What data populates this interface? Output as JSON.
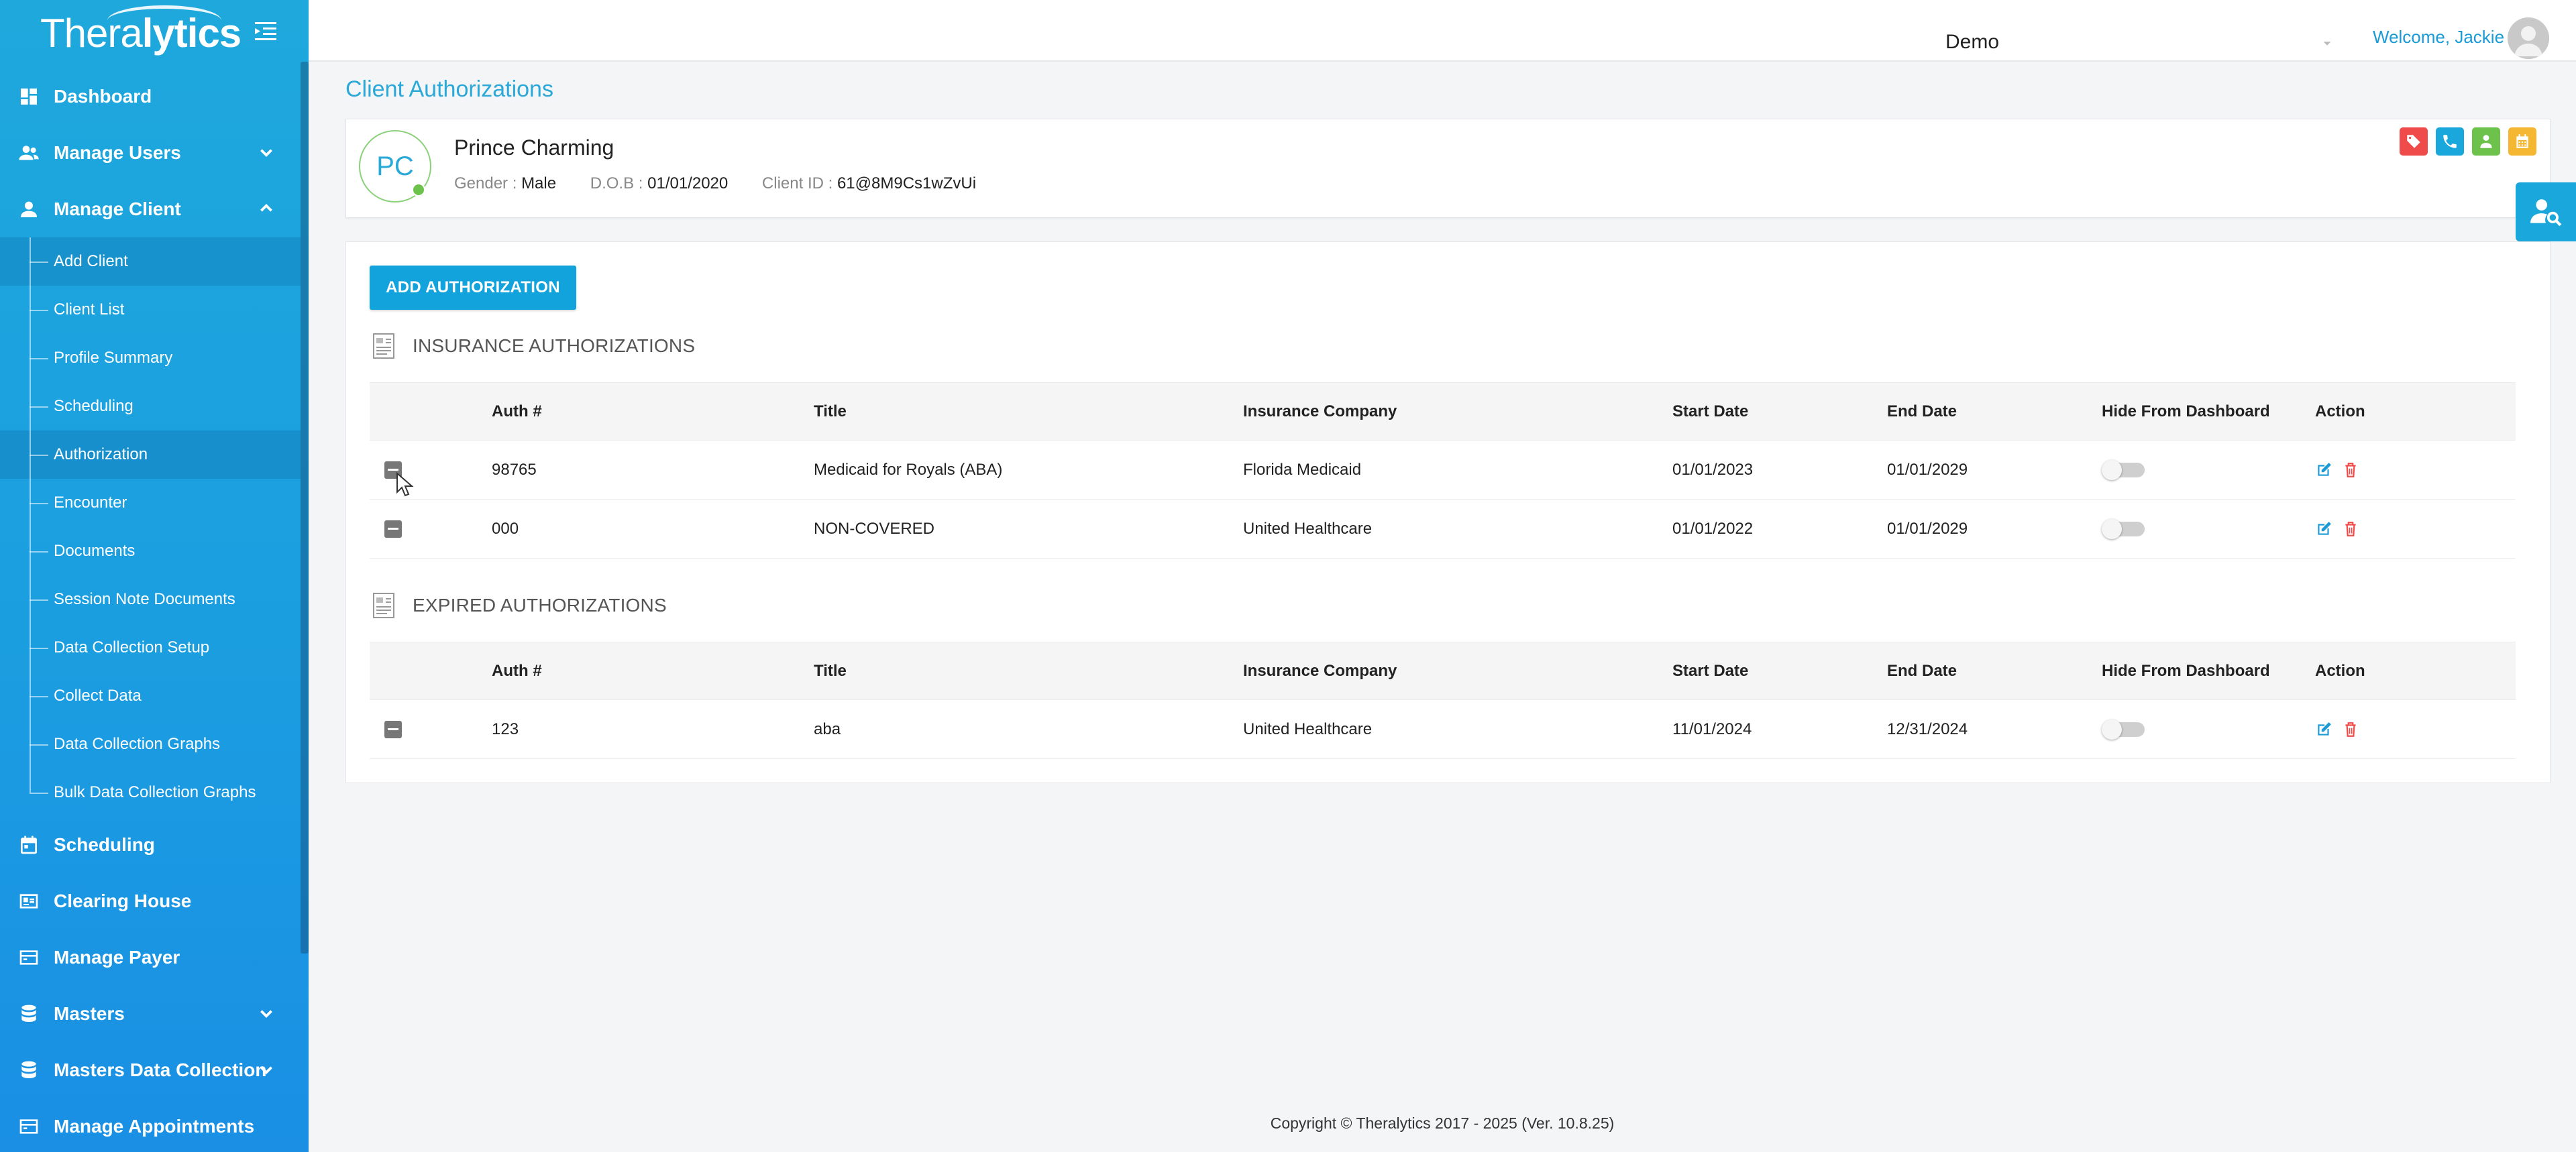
{
  "app": {
    "brand_light": "Thera",
    "brand_bold": "lytics"
  },
  "topbar": {
    "organization": "Demo",
    "welcome": "Welcome, Jackie"
  },
  "sidebar": {
    "items": [
      {
        "label": "Dashboard",
        "icon": "dashboard-icon"
      },
      {
        "label": "Manage Users",
        "icon": "users-icon"
      },
      {
        "label": "Manage Client",
        "icon": "person-icon"
      },
      {
        "label": "Scheduling",
        "icon": "calendar-icon"
      },
      {
        "label": "Clearing House",
        "icon": "id-card-icon"
      },
      {
        "label": "Manage Payer",
        "icon": "payer-icon"
      },
      {
        "label": "Masters",
        "icon": "database-icon"
      },
      {
        "label": "Masters Data Collection",
        "icon": "database-icon"
      },
      {
        "label": "Manage Appointments",
        "icon": "appointments-icon"
      }
    ],
    "client_subitems": [
      "Add Client",
      "Client List",
      "Profile Summary",
      "Scheduling",
      "Authorization",
      "Encounter",
      "Documents",
      "Session Note Documents",
      "Data Collection Setup",
      "Collect Data",
      "Data Collection Graphs",
      "Bulk Data Collection Graphs"
    ],
    "active_subitem": "Authorization"
  },
  "page": {
    "title": "Client Authorizations"
  },
  "client": {
    "initials": "PC",
    "name": "Prince Charming",
    "gender_label": "Gender : ",
    "gender": "Male",
    "dob_label": "D.O.B : ",
    "dob": "01/01/2020",
    "client_id_label": "Client ID : ",
    "client_id": "61@8M9Cs1wZvUi",
    "status_color": "#6cc24a"
  },
  "card_icon_colors": {
    "tag": "#ef4b4b",
    "phone": "#1aa7dc",
    "contact": "#6cc24a",
    "calendar": "#f5b731"
  },
  "panel": {
    "add_button": "ADD AUTHORIZATION",
    "insurance": {
      "heading": "INSURANCE AUTHORIZATIONS",
      "columns": [
        "Auth #",
        "Title",
        "Insurance Company",
        "Start Date",
        "End Date",
        "Hide From Dashboard",
        "Action"
      ],
      "rows": [
        {
          "auth": "98765",
          "title": "Medicaid for Royals (ABA)",
          "company": "Florida Medicaid",
          "start": "01/01/2023",
          "end": "01/01/2029",
          "hidden": false
        },
        {
          "auth": "000",
          "title": "NON-COVERED",
          "company": "United Healthcare",
          "start": "01/01/2022",
          "end": "01/01/2029",
          "hidden": false
        }
      ]
    },
    "expired": {
      "heading": "EXPIRED AUTHORIZATIONS",
      "columns": [
        "Auth #",
        "Title",
        "Insurance Company",
        "Start Date",
        "End Date",
        "Hide From Dashboard",
        "Action"
      ],
      "rows": [
        {
          "auth": "123",
          "title": "aba",
          "company": "United Healthcare",
          "start": "11/01/2024",
          "end": "12/31/2024",
          "hidden": false
        }
      ]
    }
  },
  "footer": {
    "text": "Copyright © Theralytics 2017 - 2025 (Ver. 10.8.25)"
  },
  "colors": {
    "accent": "#1aa7dc",
    "edit": "#1a9bd7",
    "delete": "#ef4b4b"
  }
}
